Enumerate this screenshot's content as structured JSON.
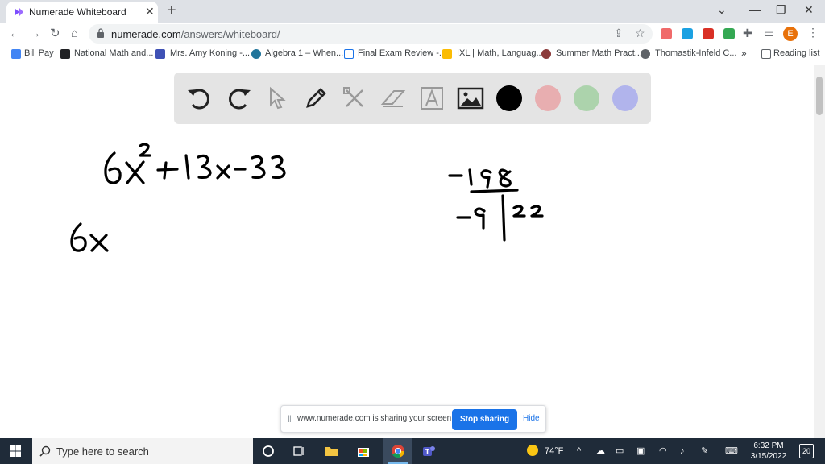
{
  "browser": {
    "tab_title": "Numerade Whiteboard",
    "url_host": "numerade.com",
    "url_path": "/answers/whiteboard/",
    "avatar_letter": "E",
    "reading_list": "Reading list"
  },
  "bookmarks": [
    {
      "label": "Bill Pay",
      "icon": "bill-pay-icon"
    },
    {
      "label": "National Math and...",
      "icon": "national-math-icon"
    },
    {
      "label": "Mrs. Amy Koning -...",
      "icon": "classroom-icon"
    },
    {
      "label": "Algebra 1 – When...",
      "icon": "wordpress-icon"
    },
    {
      "label": "Final Exam Review -...",
      "icon": "doc-icon"
    },
    {
      "label": "IXL | Math, Languag...",
      "icon": "ixl-icon"
    },
    {
      "label": "Summer Math Pract...",
      "icon": "summer-icon"
    },
    {
      "label": "Thomastik-Infeld C...",
      "icon": "globe-icon"
    }
  ],
  "whiteboard": {
    "tools": [
      "undo-icon",
      "redo-icon",
      "pointer-icon",
      "pen-icon",
      "tools-icon",
      "eraser-icon",
      "text-icon",
      "image-icon"
    ],
    "colors": [
      "#000000",
      "#e8aeb0",
      "#acd3ac",
      "#b1b4ec"
    ],
    "handwriting": {
      "expression": "6x² + 13x − 33",
      "factor_start": "6x",
      "product": "−198",
      "left_factor": "−9",
      "right_factor": "22"
    }
  },
  "share_banner": {
    "message": "www.numerade.com is sharing your screen.",
    "stop_label": "Stop sharing",
    "hide_label": "Hide"
  },
  "taskbar": {
    "search_placeholder": "Type here to search",
    "weather": "74°F",
    "time": "6:32 PM",
    "date": "3/15/2022",
    "notifications": "20"
  }
}
